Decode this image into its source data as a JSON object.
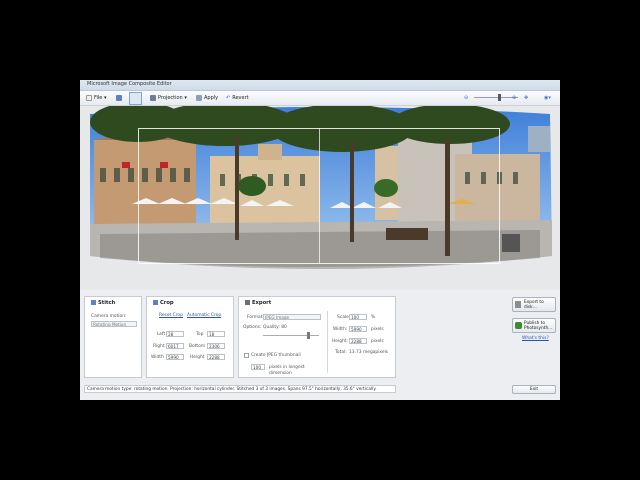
{
  "window": {
    "title": "Microsoft Image Composite Editor"
  },
  "toolbar": {
    "file_label": "File",
    "projection_label": "Projection",
    "apply_label": "Apply",
    "revert_label": "Revert"
  },
  "colors": {
    "accent": "#3a6fc4",
    "link": "#2a55b0"
  },
  "stitch": {
    "header": "Stitch",
    "camera_motion_label": "Camera motion:",
    "camera_motion_value": "Rotating Motion"
  },
  "crop": {
    "header": "Crop",
    "reset_crop": "Reset Crop",
    "automatic_crop": "Automatic Crop",
    "left_label": "Left",
    "left_value": "28",
    "top_label": "Top",
    "top_value": "18",
    "right_label": "Right",
    "right_value": "6017",
    "bottom_label": "Bottom",
    "bottom_value": "2306",
    "width_label": "Width",
    "width_value": "5990",
    "height_label": "Height",
    "height_value": "2288"
  },
  "export": {
    "header": "Export",
    "format_label": "Format:",
    "format_value": "JPEG Image",
    "options_label": "Options:",
    "quality_label": "Quality: 80",
    "quality_fraction": 0.8,
    "thumbnail_label": "Create JPEG thumbnail",
    "thumb_size_value": "100",
    "thumb_size_label": "pixels in longest dimension",
    "scale_label": "Scale:",
    "scale_value": "100",
    "scale_unit": "%",
    "width_label": "Width:",
    "width_value": "5990",
    "width_unit": "pixels",
    "height_label": "Height:",
    "height_value": "2288",
    "height_unit": "pixels",
    "total_label": "Total:",
    "total_value": "13.73 megapixels"
  },
  "right_panel": {
    "export_to_disk": "Export to disk...",
    "publish_photosynth": "Publish to Photosynth...",
    "whats_this": "What's this?"
  },
  "status": {
    "text": "Camera motion type: rotating motion. Projection: horizontal cylinder. Stitched 3 of 3 images. Spans 97.5° horizontally, 35.6° vertically."
  },
  "exit_label": "Exit"
}
